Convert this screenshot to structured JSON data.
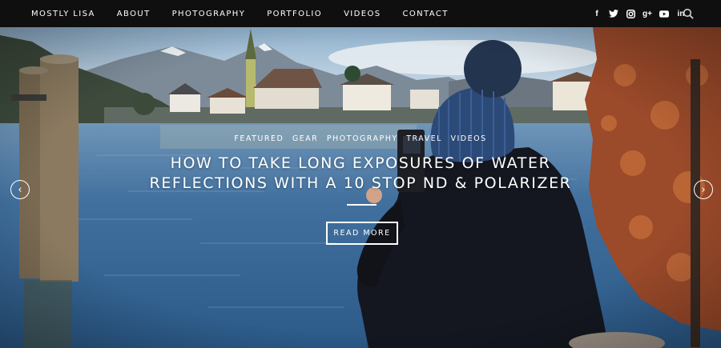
{
  "nav": {
    "items": [
      "MOSTLY LISA",
      "ABOUT",
      "PHOTOGRAPHY",
      "PORTFOLIO",
      "VIDEOS",
      "CONTACT"
    ],
    "social_icons": [
      {
        "name": "facebook-icon",
        "glyph": "f"
      },
      {
        "name": "twitter-icon",
        "glyph": "t"
      },
      {
        "name": "instagram-icon",
        "glyph": "◙"
      },
      {
        "name": "google-plus-icon",
        "glyph": "g+"
      },
      {
        "name": "youtube-icon",
        "glyph": "▶"
      },
      {
        "name": "linkedin-icon",
        "glyph": "in"
      }
    ],
    "search_icon": "search-icon"
  },
  "hero": {
    "categories": [
      "FEATURED",
      "GEAR",
      "PHOTOGRAPHY",
      "TRAVEL",
      "VIDEOS"
    ],
    "title_lines": [
      "HOW TO TAKE LONG EXPOSURES OF WATER",
      "REFLECTIONS WITH A 10 STOP ND & POLARIZER"
    ],
    "button_label": "READ MORE",
    "prev_arrow": "‹",
    "next_arrow": "›"
  },
  "colors": {
    "nav_bg": "#0f0f0f",
    "lake": "#3f6f9c",
    "sky": "#a9c3d8",
    "foliage": "#9b4a2a",
    "jacket": "#141720",
    "hat": "#2c4a78"
  }
}
